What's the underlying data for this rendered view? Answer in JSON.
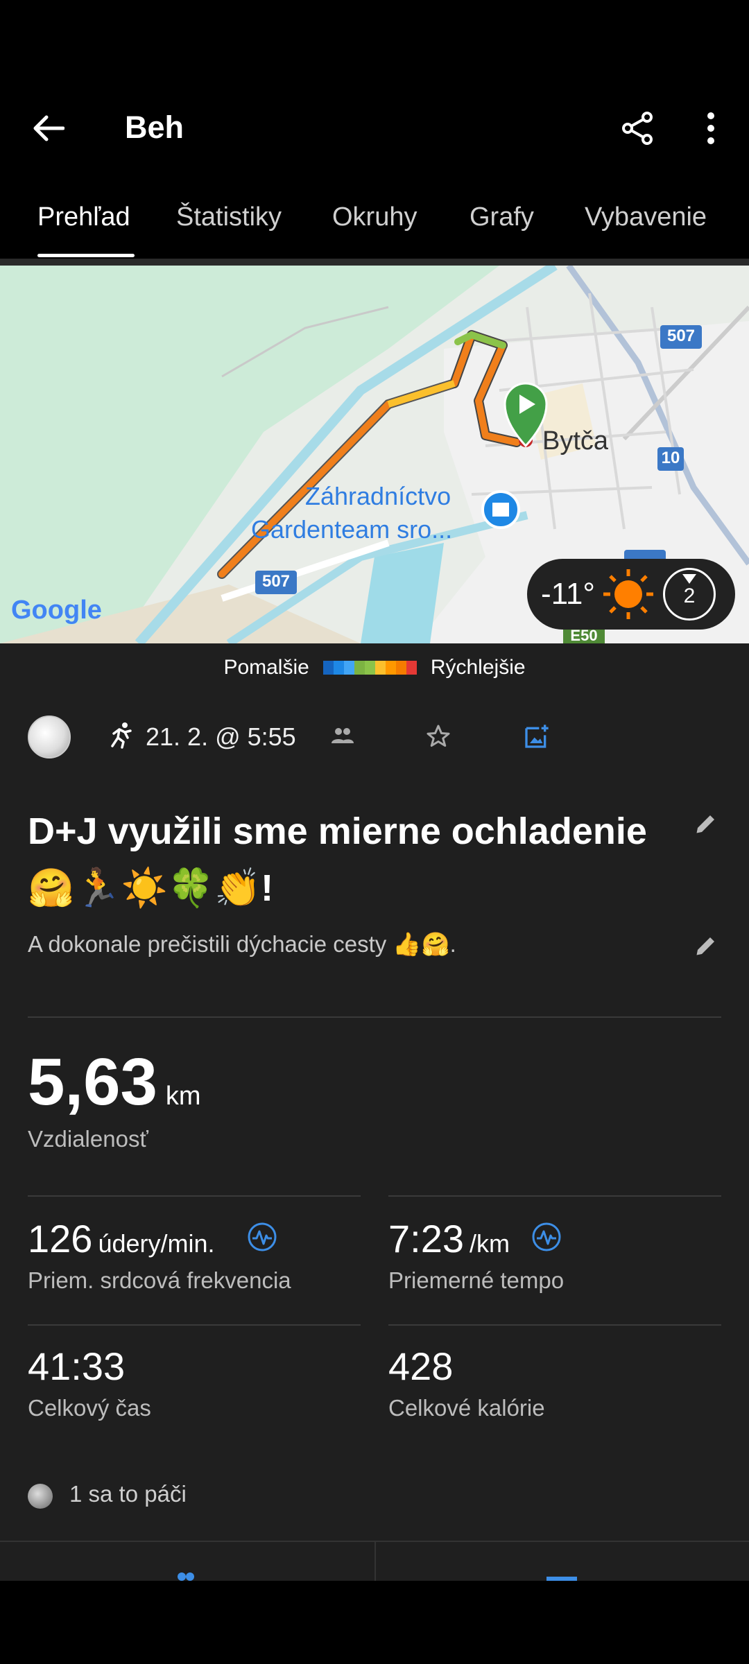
{
  "header": {
    "title": "Beh",
    "back_icon": "arrow-left-icon",
    "share_icon": "share-icon",
    "more_icon": "more-vertical-icon"
  },
  "tabs": [
    {
      "label": "Prehľad",
      "active": true
    },
    {
      "label": "Štatistiky",
      "active": false
    },
    {
      "label": "Okruhy",
      "active": false
    },
    {
      "label": "Grafy",
      "active": false
    },
    {
      "label": "Vybavenie",
      "active": false
    }
  ],
  "map": {
    "town_label": "Bytča",
    "poi_line1": "Záhradníctvo",
    "poi_line2": "Gardenteam sro...",
    "road_507": "507",
    "road_10": "10",
    "road_e50": "E50",
    "google": "Google",
    "weather": {
      "temp": "-11°",
      "icon": "sun-icon",
      "wind_level": "2"
    }
  },
  "legend": {
    "slower": "Pomalšie",
    "faster": "Rýchlejšie",
    "colors": [
      "#1565c0",
      "#1e88e5",
      "#42a5f5",
      "#7cb342",
      "#8bc34a",
      "#fbc02d",
      "#ff9800",
      "#f57c00",
      "#e53935"
    ]
  },
  "meta": {
    "date": "21. 2. @ 5:55",
    "activity_icon": "running-icon",
    "group_icon": "people-icon",
    "star_icon": "star-outline-icon",
    "photo_icon": "add-photo-icon"
  },
  "activity": {
    "title": "D+J využili sme mierne ochladenie 🤗🏃☀️🍀👏!",
    "description": "A dokonale prečistili dýchacie cesty 👍🤗."
  },
  "stats": {
    "distance_value": "5,63",
    "distance_unit": "km",
    "distance_label": "Vzdialenosť",
    "hr_value": "126",
    "hr_unit": "údery/min.",
    "hr_label": "Priem. srdcová frekvencia",
    "pace_value": "7:23",
    "pace_unit": "/km",
    "pace_label": "Priemerné tempo",
    "time_value": "41:33",
    "time_label": "Celkový čas",
    "cal_value": "428",
    "cal_label": "Celkové kalórie"
  },
  "likes": {
    "text": "1 sa to páči"
  },
  "colors": {
    "accent": "#3d8ee6",
    "background": "#1f1f1f",
    "route_orange": "#f07f1b"
  }
}
